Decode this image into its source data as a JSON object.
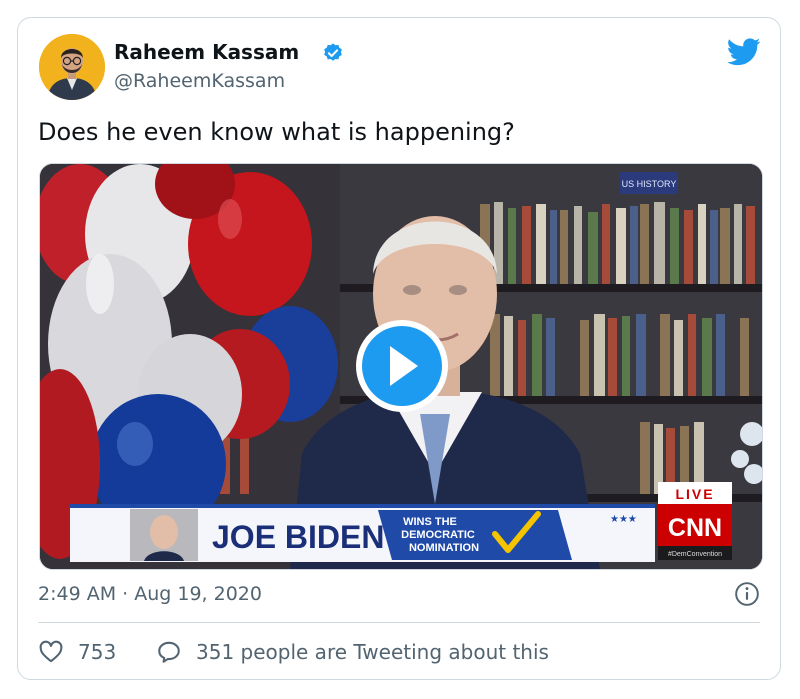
{
  "author": {
    "name": "Raheem Kassam",
    "handle": "@RaheemKassam",
    "verified": true
  },
  "tweet": {
    "text": "Does he even know what is happening?",
    "timestamp": "2:49 AM · Aug 19, 2020"
  },
  "media": {
    "type": "video",
    "chyron": {
      "name": "JOE BIDEN",
      "subtitle_lines": [
        "WINS THE",
        "DEMOCRATIC",
        "NOMINATION"
      ]
    },
    "live_badge": "LIVE",
    "network_logo": "CNN",
    "network_tag": "#DemConvention",
    "banner_text": "US HISTORY"
  },
  "actions": {
    "likes": "753",
    "tweeting": "351 people are Tweeting about this"
  },
  "colors": {
    "verified_blue": "#1d9bf0",
    "text_secondary": "#536471",
    "border": "#cfd9de",
    "cnn_red": "#cc0000"
  },
  "icons": [
    "verified-badge-icon",
    "twitter-bird-icon",
    "play-icon",
    "info-icon",
    "heart-icon",
    "speech-bubble-icon"
  ]
}
